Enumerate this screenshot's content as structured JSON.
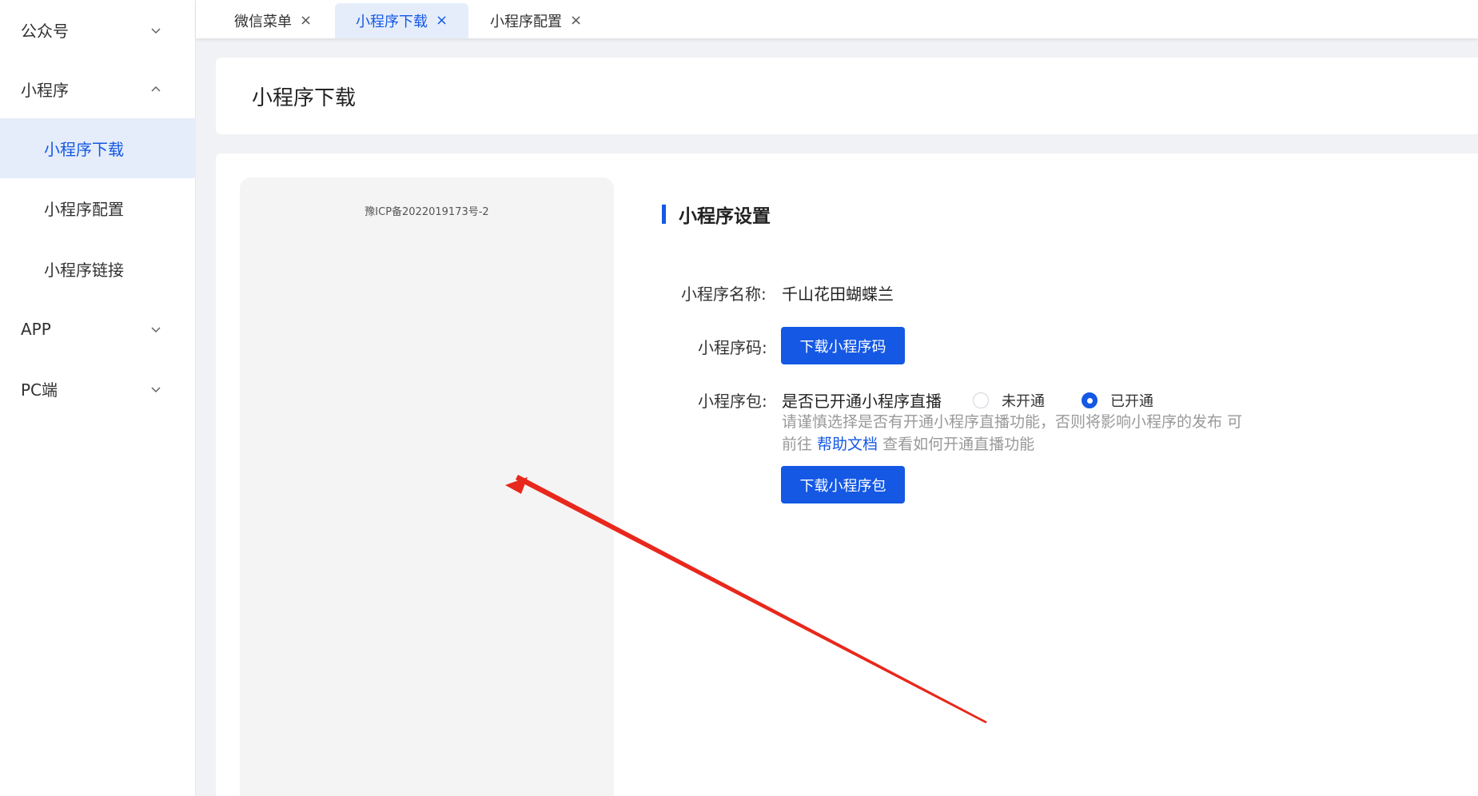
{
  "sidebar": {
    "groups": [
      {
        "label": "公众号",
        "expanded": false
      },
      {
        "label": "小程序",
        "expanded": true
      },
      {
        "label": "APP",
        "expanded": false
      },
      {
        "label": "PC端",
        "expanded": false
      }
    ],
    "items": [
      {
        "label": "小程序下载",
        "active": true
      },
      {
        "label": "小程序配置",
        "active": false
      },
      {
        "label": "小程序链接",
        "active": false
      }
    ]
  },
  "tabs": [
    {
      "label": "微信菜单",
      "close": "×"
    },
    {
      "label": "小程序下载",
      "close": "×",
      "active": true
    },
    {
      "label": "小程序配置",
      "close": "×"
    }
  ],
  "header": {
    "title": "小程序下载"
  },
  "preview": {
    "icp": "豫ICP备2022019173号-2"
  },
  "settings": {
    "section_title": "小程序设置",
    "name_label": "小程序名称:",
    "name_value": "千山花田蝴蝶兰",
    "code_label": "小程序码:",
    "code_button": "下载小程序码",
    "package_label": "小程序包:",
    "live_question": "是否已开通小程序直播",
    "radio_off": "未开通",
    "radio_on": "已开通",
    "live_selected": "已开通",
    "hint_prefix": "请谨慎选择是否有开通小程序直播功能，否则将影响小程序的发布 可前往 ",
    "hint_link": "帮助文档",
    "hint_suffix": " 查看如何开通直播功能",
    "package_button": "下载小程序包"
  },
  "colors": {
    "accent": "#1458e4",
    "active_bg": "#e5edfb",
    "annotation_arrow": "#e8281c"
  }
}
